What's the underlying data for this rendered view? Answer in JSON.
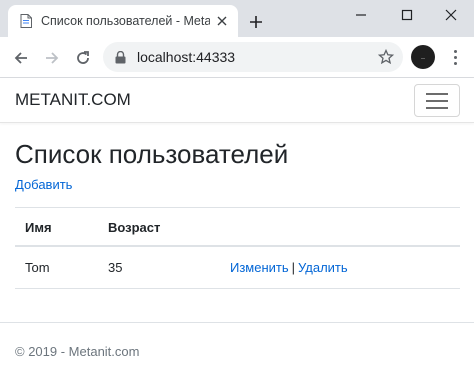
{
  "browser": {
    "tab_title": "Список пользователей - Metanit.",
    "url": "localhost:44333",
    "profile_label": "—"
  },
  "site": {
    "brand": "METANIT.COM"
  },
  "main": {
    "heading": "Список пользователей",
    "add_link": "Добавить",
    "table": {
      "headers": [
        "Имя",
        "Возраст"
      ],
      "rows": [
        {
          "name": "Tom",
          "age": "35",
          "edit": "Изменить",
          "separator": "|",
          "delete": "Удалить"
        }
      ]
    }
  },
  "footer": {
    "text": "© 2019 - Metanit.com"
  }
}
